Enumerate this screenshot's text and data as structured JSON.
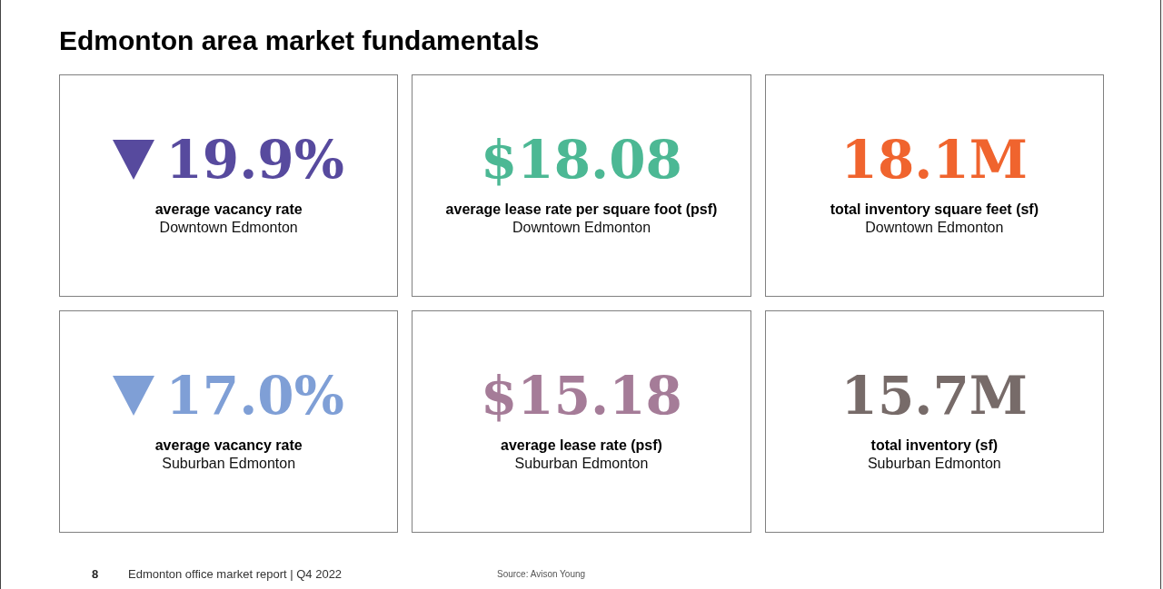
{
  "title": "Edmonton area market fundamentals",
  "cards": [
    {
      "value": "19.9%",
      "kind": "decrease",
      "color": "#574a9e",
      "label": "average vacancy rate",
      "area": "Downtown Edmonton"
    },
    {
      "value": "$18.08",
      "kind": "plain",
      "color": "#4cb894",
      "label": "average lease rate per square foot (psf)",
      "area": "Downtown Edmonton"
    },
    {
      "value": "18.1M",
      "kind": "plain",
      "color": "#f0642e",
      "label": "total inventory square feet (sf)",
      "area": "Downtown Edmonton"
    },
    {
      "value": "17.0%",
      "kind": "decrease",
      "color": "#7f9fd6",
      "label": "average vacancy rate",
      "area": "Suburban Edmonton"
    },
    {
      "value": "$15.18",
      "kind": "plain",
      "color": "#a57c98",
      "label": "average lease rate (psf)",
      "area": "Suburban Edmonton"
    },
    {
      "value": "15.7M",
      "kind": "plain",
      "color": "#776b69",
      "label": "total inventory (sf)",
      "area": "Suburban Edmonton"
    }
  ],
  "footer": {
    "page": "8",
    "report": "Edmonton office market report | Q4 2022",
    "source": "Source: Avison Young"
  }
}
